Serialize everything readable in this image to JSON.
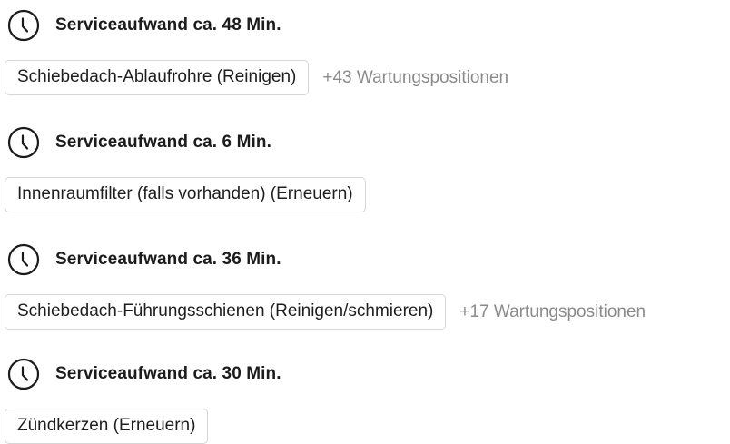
{
  "services": [
    {
      "duration_label": "Serviceaufwand ca. 48 Min.",
      "item_label": "Schiebedach-Ablaufrohre (Reinigen)",
      "more_label": "+43 Wartungspositionen"
    },
    {
      "duration_label": "Serviceaufwand ca. 6 Min.",
      "item_label": "Innenraumfilter (falls vorhanden) (Erneuern)",
      "more_label": ""
    },
    {
      "duration_label": "Serviceaufwand ca. 36 Min.",
      "item_label": "Schiebedach-Führungsschienen (Reinigen/schmieren)",
      "more_label": "+17 Wartungspositionen"
    },
    {
      "duration_label": "Serviceaufwand ca. 30 Min.",
      "item_label": "Zündkerzen (Erneuern)",
      "more_label": ""
    }
  ],
  "icons": {
    "duration": "clock-icon"
  },
  "colors": {
    "heading_text": "#1c1c1c",
    "chip_border": "#d6d6d6",
    "more_text": "#8a8a8a"
  }
}
